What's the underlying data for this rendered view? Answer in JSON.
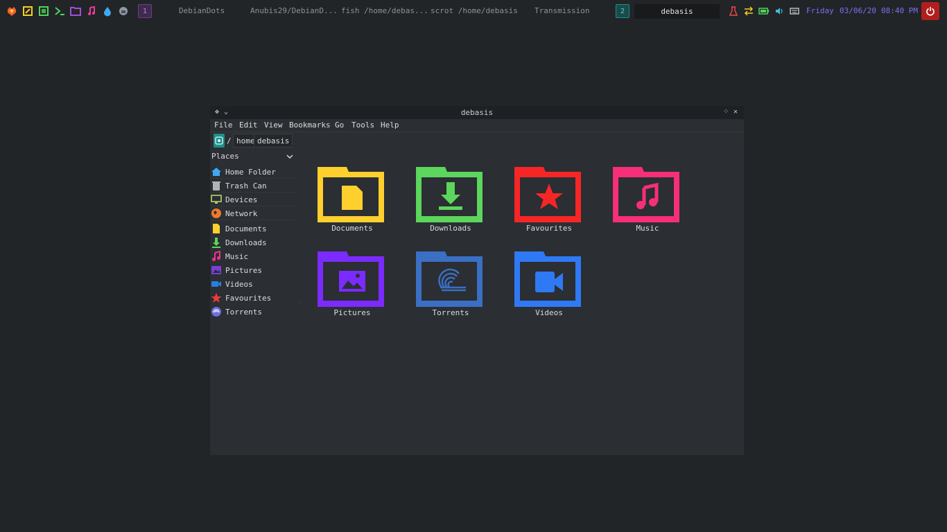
{
  "panel": {
    "launchers": [
      "firefox-icon",
      "text-editor-icon",
      "sublime-icon",
      "terminal-icon",
      "files-icon",
      "music-icon",
      "water-drop-icon",
      "system-icon"
    ],
    "workspace_1": "1",
    "tasks": [
      "DebianDots",
      "Anubis29/DebianD...",
      "fish /home/debas...",
      "scrot /home/debasis",
      "Transmission"
    ],
    "workspace_2": "2",
    "search_text": "debasis",
    "tray": [
      "download-monitor-icon",
      "network-arrows-icon",
      "battery-icon",
      "volume-icon",
      "keyboard-icon"
    ],
    "day": "Friday",
    "date": "03/06/20",
    "time": "08:40 PM",
    "colors": {
      "accent": "#7a6ff0",
      "power": "#b21e1e",
      "workspace_1": "#6b3f8c",
      "workspace_2": "#1d8f8c"
    }
  },
  "window": {
    "title": "debasis",
    "menu": [
      "File",
      "Edit",
      "View",
      "Bookmarks",
      "Go",
      "Tools",
      "Help"
    ],
    "path": {
      "root": "/",
      "crumbs": [
        "home",
        "debasis"
      ]
    },
    "places_header": "Places",
    "places": [
      {
        "label": "Home Folder",
        "icon": "home-icon",
        "color": "#3fa9f5"
      },
      {
        "label": "Trash Can",
        "icon": "trash-icon",
        "color": "#b3b3b3"
      },
      {
        "label": "Devices",
        "icon": "monitor-icon",
        "color": "#b4d96b"
      },
      {
        "label": "Network",
        "icon": "network-icon",
        "color": "#f07a2b"
      },
      {
        "label": "Documents",
        "icon": "document-icon",
        "color": "#fdd02e"
      },
      {
        "label": "Downloads",
        "icon": "download-icon",
        "color": "#5cd65c"
      },
      {
        "label": "Music",
        "icon": "music-note-icon",
        "color": "#f0338c"
      },
      {
        "label": "Pictures",
        "icon": "picture-icon",
        "color": "#7a3fd6"
      },
      {
        "label": "Videos",
        "icon": "video-icon",
        "color": "#2a7de1"
      },
      {
        "label": "Favourites",
        "icon": "star-icon",
        "color": "#f03a3a"
      },
      {
        "label": "Torrents",
        "icon": "torrent-icon",
        "color": "#6f6fe0"
      }
    ],
    "folders": [
      {
        "label": "Documents",
        "color": "#fdd02e",
        "icon": "document-icon"
      },
      {
        "label": "Downloads",
        "color": "#5cd65c",
        "icon": "download-icon"
      },
      {
        "label": "Favourites",
        "color": "#f72626",
        "icon": "star-icon"
      },
      {
        "label": "Music",
        "color": "#f72e7a",
        "icon": "music-note-icon"
      },
      {
        "label": "Pictures",
        "color": "#7b2bff",
        "icon": "picture-icon"
      },
      {
        "label": "Torrents",
        "color": "#3a6fc4",
        "icon": "torrent-icon"
      },
      {
        "label": "Videos",
        "color": "#2f79f5",
        "icon": "video-icon"
      }
    ]
  }
}
